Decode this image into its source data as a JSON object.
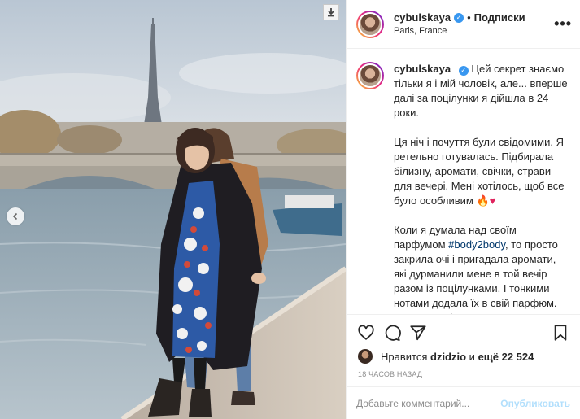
{
  "post": {
    "author": "cybulskaya",
    "follow_dot": "•",
    "follow_label": "Подписки",
    "location": "Paris, France",
    "more": "•••",
    "verified_icon": "check-badge-icon",
    "caption": {
      "p1": "Цей секрет знаємо тільки я і мій чоловік, але... вперше далі за поцілунки я дійшла в 24 роки.",
      "p2": "Ця ніч і почуття були свідомими. Я ретельно готувалась. Підбирала білизну, аромати, свічки, страви для вечері. Мені хотілось, щоб все було особливим",
      "p2_emoji": "🔥♥",
      "p3_before": "Коли я думала над своїм парфумом ",
      "p3_hashtag": "#body2body",
      "p3_after": ", то просто закрила очі і пригадала аромати, які дурманили мене в той вечір разом із поцілунками. І тонкими нотами додала їх в свій парфюм. Бо жодна жінка не встоїть перед справжнім коханням",
      "p3_emoji": "♥"
    },
    "likes": {
      "prefix": "Нравится",
      "liker": "dzidzio",
      "middle": "и",
      "count": "ещё 22 524"
    },
    "timestamp": "18 часов назад",
    "comment_placeholder": "Добавьте комментарий...",
    "publish_label": "Опубликовать"
  },
  "icons": [
    "download-icon",
    "chevron-left-icon",
    "heart-icon",
    "comment-icon",
    "share-icon",
    "bookmark-icon"
  ],
  "colors": {
    "accent_blue": "#3897f0",
    "publish_disabled": "#b2dffc",
    "hashtag": "#00376b",
    "text": "#262626",
    "muted": "#8e8e8e"
  }
}
